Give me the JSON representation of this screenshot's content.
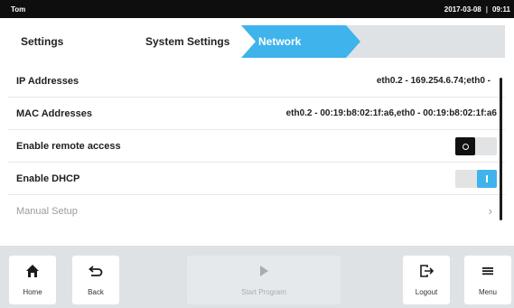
{
  "topbar": {
    "user": "Tom",
    "date": "2017-03-08",
    "time": "09:11"
  },
  "breadcrumbs": [
    {
      "label": "Settings",
      "active": false
    },
    {
      "label": "System Settings",
      "active": false
    },
    {
      "label": "Network",
      "active": true
    }
  ],
  "settings": {
    "ip": {
      "label": "IP Addresses",
      "value": "eth0.2 - 169.254.6.74;eth0 -"
    },
    "mac": {
      "label": "MAC Addresses",
      "value": "eth0.2 - 00:19:b8:02:1f:a6,eth0 - 00:19:b8:02:1f:a6"
    },
    "remote": {
      "label": "Enable remote access",
      "enabled": false
    },
    "dhcp": {
      "label": "Enable DHCP",
      "enabled": true
    },
    "manual": {
      "label": "Manual Setup",
      "chevron": "›"
    }
  },
  "bottombar": {
    "home": {
      "label": "Home",
      "icon": "home-icon"
    },
    "back": {
      "label": "Back",
      "icon": "back-arrow-icon"
    },
    "start": {
      "label": "Start Program",
      "icon": "play-icon",
      "enabled": false
    },
    "logout": {
      "label": "Logout",
      "icon": "logout-icon"
    },
    "menu": {
      "label": "Menu",
      "icon": "menu-icon"
    }
  },
  "colors": {
    "accent": "#3fb3ec",
    "topbar_bg": "#0e0e0e",
    "chrome_bg": "#dfe2e4"
  }
}
